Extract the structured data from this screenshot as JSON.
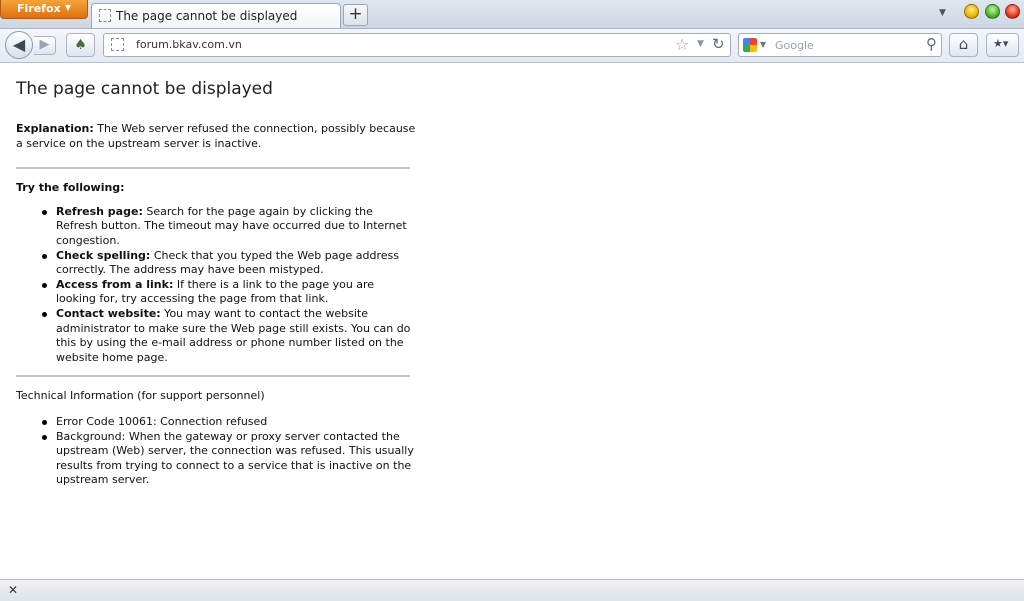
{
  "browser": {
    "app_button": "Firefox",
    "tab_title": "The page cannot be displayed",
    "new_tab_symbol": "+",
    "url": "forum.bkav.com.vn",
    "search_placeholder": "Google"
  },
  "page": {
    "title": "The page cannot be displayed",
    "explanation_label": "Explanation:",
    "explanation_text": " The Web server refused the connection, possibly because a service on the upstream server is inactive.",
    "try_heading": "Try the following:",
    "suggestions": [
      {
        "label": "Refresh page:",
        "text": " Search for the page again by clicking the Refresh button. The timeout may have occurred due to Internet congestion."
      },
      {
        "label": "Check spelling:",
        "text": " Check that you typed the Web page address correctly. The address may have been mistyped."
      },
      {
        "label": "Access from a link:",
        "text": " If there is a link to the page you are looking for, try accessing the page from that link."
      },
      {
        "label": "Contact website:",
        "text": " You may want to contact the website administrator to make sure the Web page still exists. You can do this by using the e-mail address or phone number listed on the website home page."
      }
    ],
    "tech_heading": "Technical Information (for support personnel)",
    "tech_items": [
      "Error Code 10061: Connection refused",
      "Background: When the gateway or proxy server contacted the upstream (Web) server, the connection was refused. This usually results from trying to connect to a service that is inactive on the upstream server."
    ]
  },
  "colors": {
    "firefox_button": "#e8801a",
    "divider": "#c5c5c5"
  }
}
